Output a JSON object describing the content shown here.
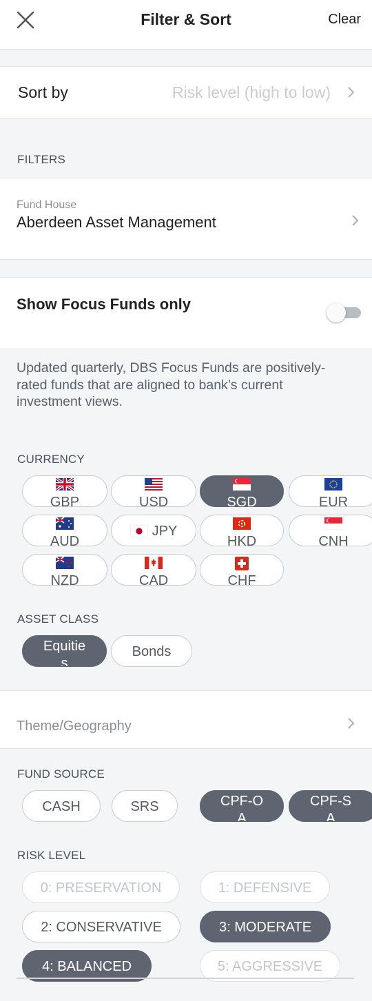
{
  "header": {
    "title": "Filter & Sort",
    "clear_label": "Clear"
  },
  "sort": {
    "label": "Sort by",
    "value": "Risk level (high to low)"
  },
  "filters_label": "FILTERS",
  "fund_house": {
    "label": "Fund House",
    "value": "Aberdeen Asset Management"
  },
  "focus_funds": {
    "label": "Show Focus Funds only",
    "enabled": false,
    "description": "Updated quarterly, DBS Focus Funds are positively-rated funds that are aligned to bank’s current investment views."
  },
  "currency": {
    "label": "CURRENCY",
    "options": [
      {
        "code": "GBP",
        "flag": "uk-flag-icon",
        "selected": false
      },
      {
        "code": "USD",
        "flag": "us-flag-icon",
        "selected": false
      },
      {
        "code": "SGD",
        "flag": "singapore-flag-icon",
        "selected": true
      },
      {
        "code": "EUR",
        "flag": "eu-flag-icon",
        "selected": false
      },
      {
        "code": "AUD",
        "flag": "australia-flag-icon",
        "selected": false
      },
      {
        "code": "JPY",
        "flag": "japan-flag-icon",
        "selected": false
      },
      {
        "code": "HKD",
        "flag": "hong-kong-flag-icon",
        "selected": false
      },
      {
        "code": "CNH",
        "flag": "singapore-flag-icon",
        "selected": false
      },
      {
        "code": "NZD",
        "flag": "new-zealand-flag-icon",
        "selected": false
      },
      {
        "code": "CAD",
        "flag": "canada-flag-icon",
        "selected": false
      },
      {
        "code": "CHF",
        "flag": "switzerland-flag-icon",
        "selected": false
      }
    ]
  },
  "asset_class": {
    "label": "ASSET CLASS",
    "options": [
      {
        "label": "Equities",
        "line1": "Equitie",
        "line2": "s",
        "selected": true
      },
      {
        "label": "Bonds",
        "selected": false
      }
    ]
  },
  "theme": {
    "label": "Theme/Geography"
  },
  "fund_source": {
    "label": "FUND SOURCE",
    "options": [
      {
        "label": "CASH",
        "selected": false
      },
      {
        "label": "SRS",
        "selected": false
      },
      {
        "label": "CPF-OA",
        "line1": "CPF-O",
        "line2": "A",
        "selected": true
      },
      {
        "label": "CPF-SA",
        "line1": "CPF-S",
        "line2": "A",
        "selected": true
      }
    ]
  },
  "risk_level": {
    "label": "RISK LEVEL",
    "options": [
      {
        "label": "0: PRESERVATION",
        "state": "disabled"
      },
      {
        "label": "1: DEFENSIVE",
        "state": "disabled"
      },
      {
        "label": "2: CONSERVATIVE",
        "state": "normal"
      },
      {
        "label": "3: MODERATE",
        "state": "selected"
      },
      {
        "label": "4: BALANCED",
        "state": "selected"
      },
      {
        "label": "5: AGGRESSIVE",
        "state": "disabled"
      }
    ]
  },
  "colors": {
    "selected_chip": "#5e6570",
    "background": "#f3f5f7",
    "toggle_track": "#b8bdc2"
  }
}
